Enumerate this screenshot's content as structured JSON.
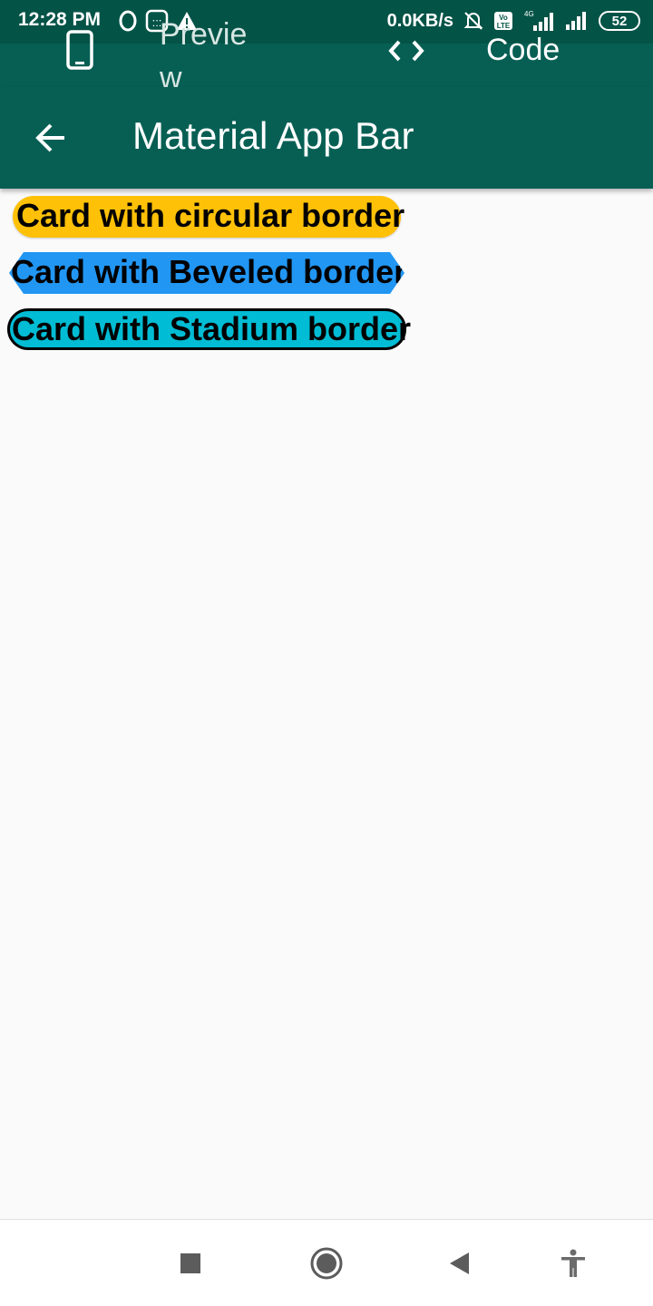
{
  "status_bar": {
    "time": "12:28 PM",
    "speed": "0.0KB/s",
    "battery": "52",
    "icons": [
      "opera-icon",
      "sim-icon",
      "warning-icon",
      "mute-icon",
      "volte-icon",
      "signal-4g-icon",
      "signal-icon",
      "battery-icon"
    ]
  },
  "tabs": {
    "preview_label": "Preview",
    "code_label": "Code"
  },
  "app_bar": {
    "title": "Material App Bar"
  },
  "cards": {
    "circular": "Card with circular border",
    "beveled": "Card with Beveled border",
    "stadium": "Card with Stadium border"
  },
  "colors": {
    "status_bar": "#045347",
    "app_bar": "#075f54",
    "circular_card": "#ffc107",
    "beveled_card": "#2196f3",
    "stadium_card": "#00bcd4",
    "background": "#fafafa"
  }
}
